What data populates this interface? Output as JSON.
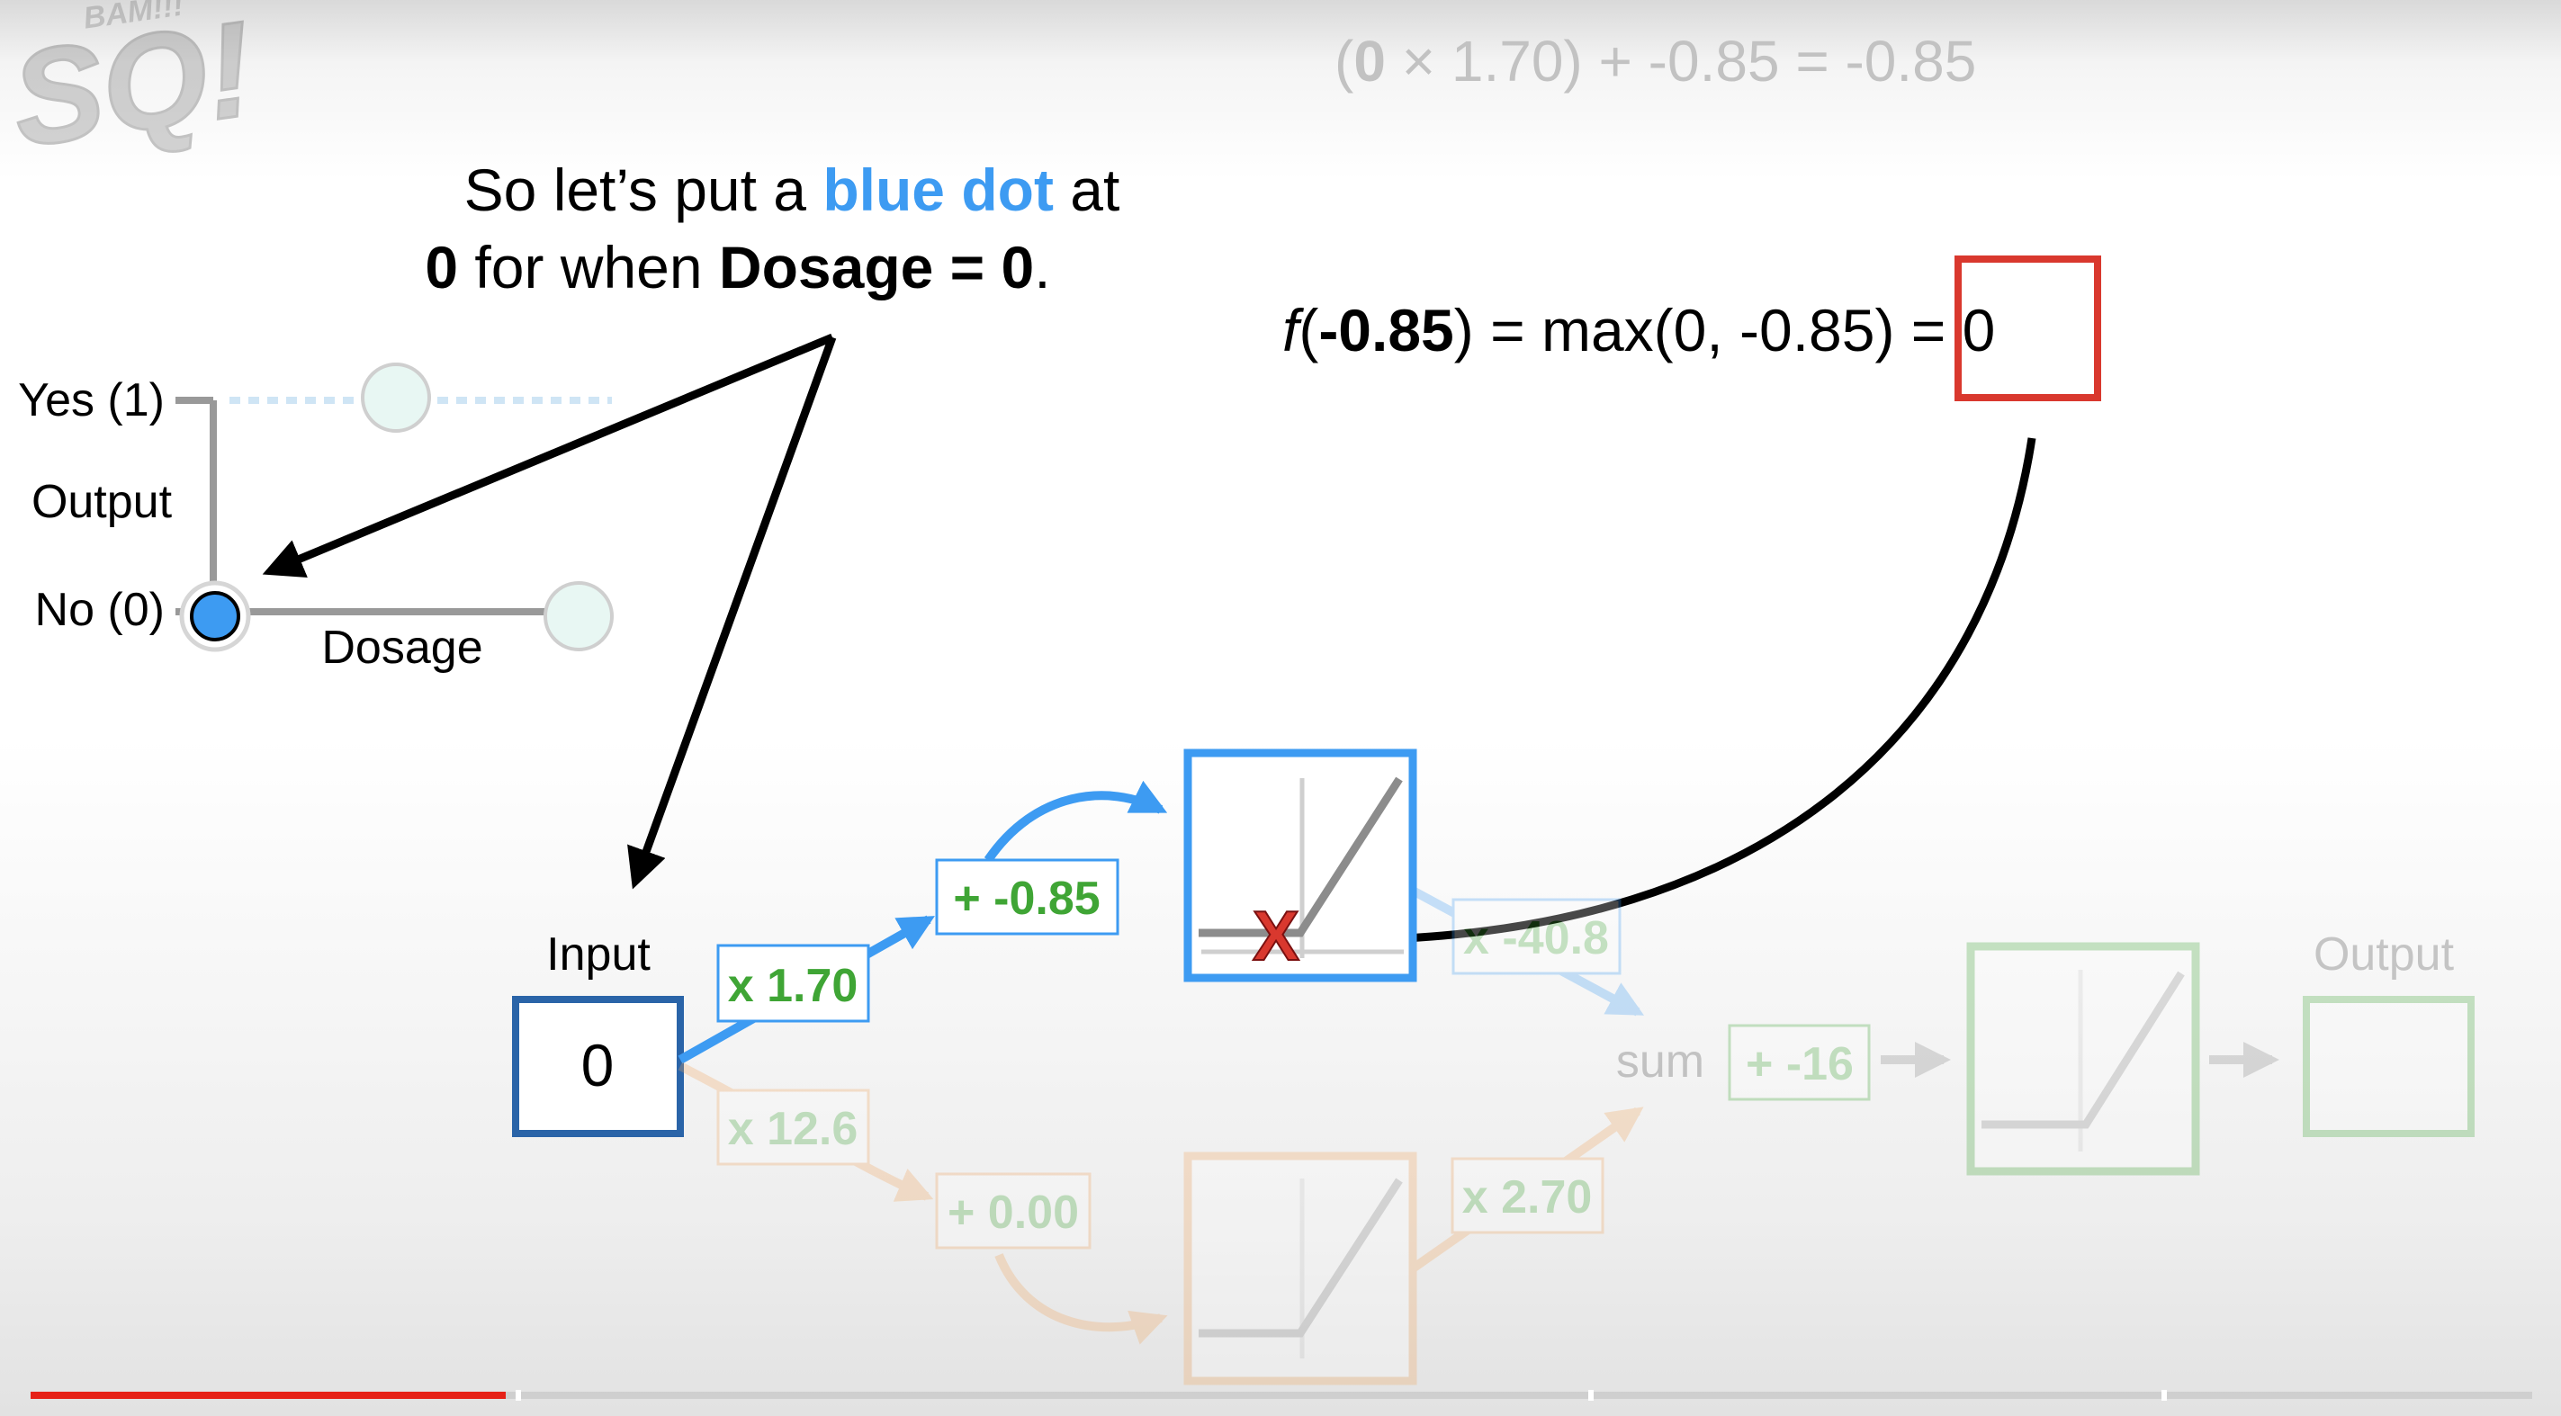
{
  "logo": {
    "main": "SQ!",
    "small": "BAM!!!"
  },
  "top_equation": {
    "bold_zero": "0",
    "rest": " × 1.70) + -0.85 = -0.85",
    "open_paren": "("
  },
  "caption": {
    "line1_a": "So let’s put a ",
    "line1_blue": "blue dot",
    "line1_b": " at",
    "line2_bold_a": "0",
    "line2_mid": " for when ",
    "line2_bold_b": "Dosage = 0",
    "line2_end": "."
  },
  "relu_equation": {
    "f": "f",
    "open": "(",
    "arg": "-0.85",
    "rest": ") = max(0, -0.85) ",
    "result": "= 0"
  },
  "graph": {
    "yes_label": "Yes (1)",
    "output_label": "Output",
    "no_label": "No (0)",
    "x_label": "Dosage"
  },
  "network": {
    "input_label": "Input",
    "input_value": "0",
    "w1_top": "x 1.70",
    "b1_top": "+ -0.85",
    "w2_top": "x -40.8",
    "w1_bottom": "x 12.6",
    "b1_bottom": "+ 0.00",
    "w2_bottom": "x 2.70",
    "sum_label": "sum",
    "final_bias": "+ -16",
    "output_label": "Output",
    "x_mark": "X"
  },
  "colors": {
    "blue": "#3d9bf2",
    "dark_blue": "#2a64a8",
    "green": "#3fa535",
    "orange": "#f0a45c",
    "red": "#d9382e"
  },
  "progress": {
    "played_fraction": 0.19
  }
}
